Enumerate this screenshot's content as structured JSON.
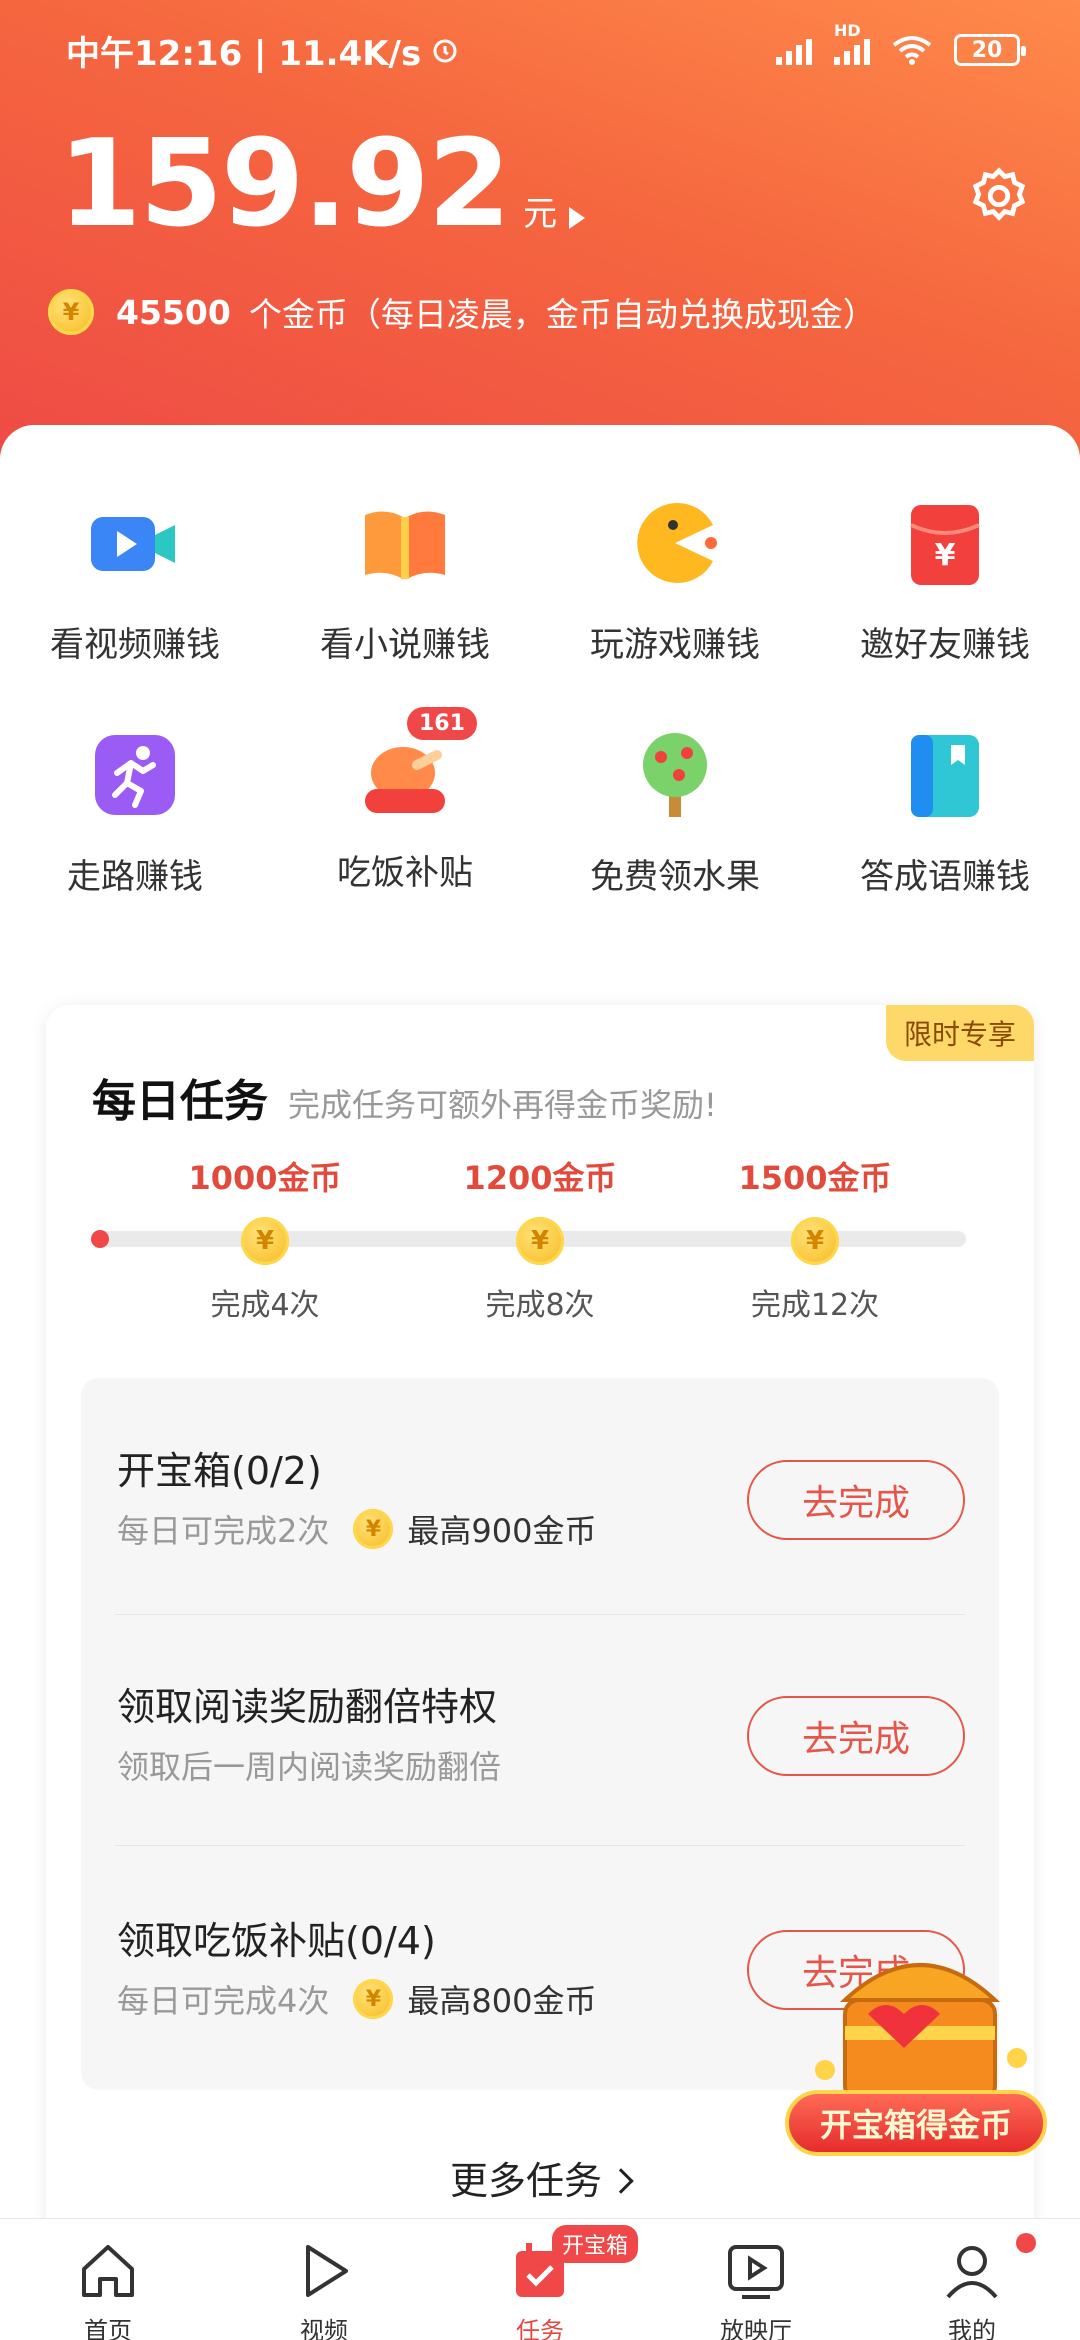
{
  "status_bar": {
    "time": "中午12:16 | 11.4K/s",
    "battery": "20",
    "net_label": "HD"
  },
  "balance": {
    "amount": "159.92",
    "unit": "元"
  },
  "coins": {
    "icon": "coin-icon",
    "count": "45500",
    "text": "个金币（每日凌晨，金币自动兑换成现金）"
  },
  "grid": [
    {
      "label": "看视频赚钱",
      "icon": "video-camera-icon"
    },
    {
      "label": "看小说赚钱",
      "icon": "book-icon"
    },
    {
      "label": "玩游戏赚钱",
      "icon": "pacman-icon"
    },
    {
      "label": "邀好友赚钱",
      "icon": "red-envelope-icon"
    },
    {
      "label": "走路赚钱",
      "icon": "running-icon"
    },
    {
      "label": "吃饭补贴",
      "icon": "chicken-leg-icon",
      "badge": "161"
    },
    {
      "label": "免费领水果",
      "icon": "fruit-tree-icon"
    },
    {
      "label": "答成语赚钱",
      "icon": "idiom-book-icon"
    }
  ],
  "daily": {
    "tag": "限时专享",
    "title": "每日任务",
    "subtitle": "完成任务可额外再得金币奖励!",
    "milestones": [
      {
        "reward": "1000金币",
        "count": "完成4次"
      },
      {
        "reward": "1200金币",
        "count": "完成8次"
      },
      {
        "reward": "1500金币",
        "count": "完成12次"
      }
    ],
    "tasks": [
      {
        "name": "开宝箱(0/2)",
        "desc": "每日可完成2次",
        "reward": "最高900金币",
        "button": "去完成"
      },
      {
        "name": "领取阅读奖励翻倍特权",
        "desc": "领取后一周内阅读奖励翻倍",
        "reward": "",
        "button": "去完成"
      },
      {
        "name": "领取吃饭补贴(0/4)",
        "desc": "每日可完成4次",
        "reward": "最高800金币",
        "button": "去完成"
      }
    ],
    "more": "更多任务"
  },
  "floating": {
    "label": "开宝箱得金币"
  },
  "coin_glyph": "¥",
  "tabbar": [
    {
      "label": "首页",
      "icon": "home-icon"
    },
    {
      "label": "视频",
      "icon": "play-icon"
    },
    {
      "label": "任务",
      "icon": "task-calendar-icon",
      "badge": "开宝箱",
      "active": true
    },
    {
      "label": "放映厅",
      "icon": "screen-play-icon"
    },
    {
      "label": "我的",
      "icon": "user-icon",
      "dot": true
    }
  ],
  "colors": {
    "accent": "#e5463f",
    "header_top": "#ff8a4a",
    "header_bottom": "#ee4a45",
    "coin": "#f7b718"
  }
}
